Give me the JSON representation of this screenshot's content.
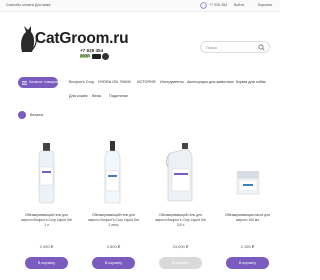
{
  "topbar": {
    "link_left_1": "Способы оплаты",
    "link_left_2": "Доставка",
    "phone": "+7 926 454",
    "link_right_1": "Войти",
    "link_right_2": "Корзина"
  },
  "logo": {
    "brand": "CatGroom.ru",
    "phone": "+7 926 454 3681",
    "mir": "МИР"
  },
  "search": {
    "placeholder": "Поиск"
  },
  "catalog_button": {
    "label": "Каталог товаров"
  },
  "nav": {
    "row1": [
      "Bonjour's Corp",
      "HYDRA ON",
      "SHIMI",
      "ИСТОРИЯ",
      "Инструменты",
      "Аксессуары для животных",
      "Корма для собак"
    ],
    "row2": [
      "Для кошек",
      "Весы",
      "Подстилки"
    ]
  },
  "breadcrumb": {
    "label": "Каталог"
  },
  "products": [
    {
      "name": "Обезжиривающий гель для шерсти Bonjour's Corp Liquid Gel 1 л",
      "price": "2,050 ₽",
      "button": "В корзину",
      "disabled": false
    },
    {
      "name": "Обезжиривающий гель для шерсти Bonjour's Corp Liquid Gel 1 литр",
      "price": "4,500 ₽",
      "button": "В корзину",
      "disabled": false
    },
    {
      "name": "Обезжиривающий гель для шерсти Bonjour's Corp Liquid Gel 3,8 л",
      "price": "24,000 ₽",
      "button": "В корзину",
      "disabled": true
    },
    {
      "name": "Обезжиривающая паста для шерсти 100 мл",
      "price": "2,150 ₽",
      "button": "В корзину",
      "disabled": false
    }
  ],
  "colors": {
    "accent": "#7a5bc0",
    "disabled": "#d9d9d9"
  }
}
